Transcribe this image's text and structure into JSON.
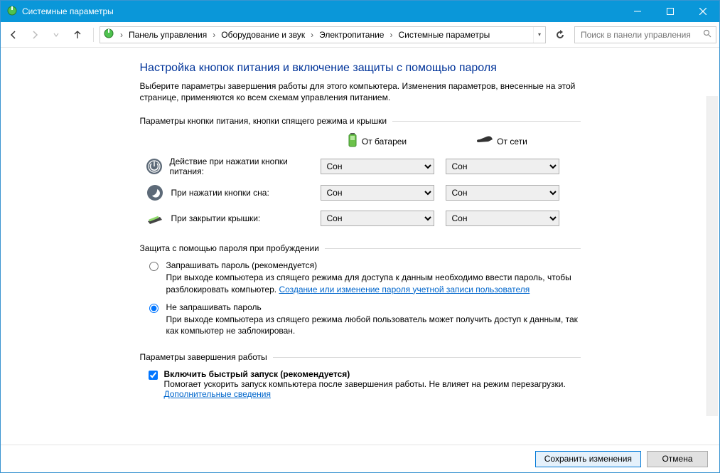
{
  "window": {
    "title": "Системные параметры"
  },
  "breadcrumb": {
    "parts": [
      "Панель управления",
      "Оборудование и звук",
      "Электропитание",
      "Системные параметры"
    ]
  },
  "search": {
    "placeholder": "Поиск в панели управления"
  },
  "page": {
    "title": "Настройка кнопок питания и включение защиты с помощью пароля",
    "desc": "Выберите параметры завершения работы для этого компьютера. Изменения параметров, внесенные на этой странице, применяются ко всем схемам управления питанием."
  },
  "buttons_section": {
    "header": "Параметры кнопки питания, кнопки спящего режима и крышки",
    "col_battery": "От батареи",
    "col_ac": "От сети",
    "rows": [
      {
        "label": "Действие при нажатии кнопки питания:",
        "battery": "Сон",
        "ac": "Сон"
      },
      {
        "label": "При нажатии кнопки сна:",
        "battery": "Сон",
        "ac": "Сон"
      },
      {
        "label": "При закрытии крышки:",
        "battery": "Сон",
        "ac": "Сон"
      }
    ]
  },
  "password_section": {
    "header": "Защита с помощью пароля при пробуждении",
    "opt_require_title": "Запрашивать пароль (рекомендуется)",
    "opt_require_desc": "При выходе компьютера из спящего режима для доступа к данным необходимо ввести пароль, чтобы разблокировать компьютер. ",
    "opt_require_link": "Создание или изменение пароля учетной записи пользователя",
    "opt_none_title": "Не запрашивать пароль",
    "opt_none_desc": "При выходе компьютера из спящего режима любой пользователь может получить доступ к данным, так как компьютер не заблокирован.",
    "selected": "none"
  },
  "shutdown_section": {
    "header": "Параметры завершения работы",
    "fast_title": "Включить быстрый запуск (рекомендуется)",
    "fast_desc": "Помогает ускорить запуск компьютера после завершения работы. Не влияет на режим перезагрузки. ",
    "fast_link": "Дополнительные сведения",
    "fast_checked": true
  },
  "footer": {
    "save": "Сохранить изменения",
    "cancel": "Отмена"
  }
}
